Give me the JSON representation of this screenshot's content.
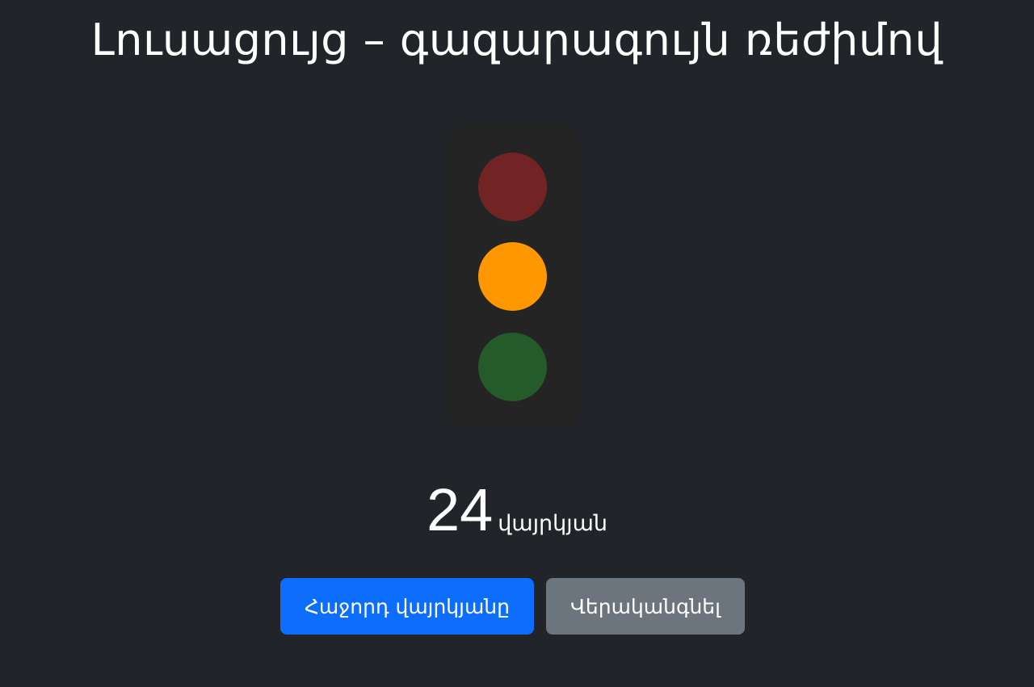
{
  "header": {
    "title": "Լուսացույց – գազարագույն ռեժիմով"
  },
  "traffic_light": {
    "housing_color": "#242424",
    "lamps": [
      {
        "name": "red",
        "color": "#722424",
        "active": false
      },
      {
        "name": "yellow",
        "color": "#ff9800",
        "active": true
      },
      {
        "name": "green",
        "color": "#255a2a",
        "active": false
      }
    ]
  },
  "timer": {
    "value": "24",
    "unit": "վայրկյան"
  },
  "buttons": {
    "next_label": "Հաջորդ վայրկյանը",
    "next_color": "#0d6efd",
    "reset_label": "Վերականգնել",
    "reset_color": "#6c757d"
  },
  "theme": {
    "background": "#212529"
  }
}
